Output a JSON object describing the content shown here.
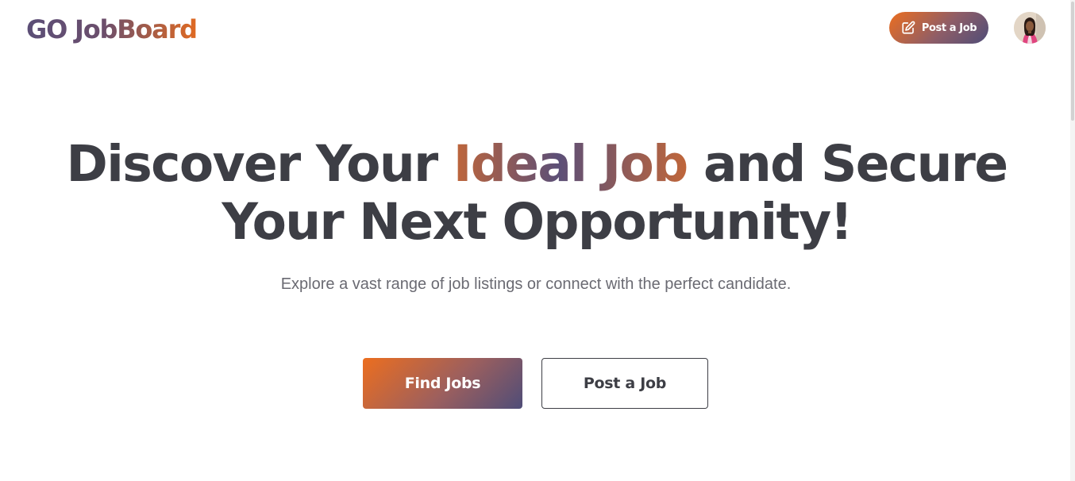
{
  "header": {
    "logo": "GO JobBoard",
    "post_job_label": "Post a Job",
    "post_job_icon": "edit-icon",
    "avatar_icon": "user-avatar"
  },
  "hero": {
    "title_pre": "Discover Your",
    "title_accent": "Ideal Job",
    "title_post": "and Secure",
    "title_line2": "Your Next Opportunity!",
    "subtitle": "Explore a vast range of job listings or connect with the perfect candidate."
  },
  "actions": {
    "find_jobs_label": "Find Jobs",
    "post_job_label": "Post a Job"
  },
  "colors": {
    "brand_orange": "#ec6e1f",
    "brand_purple": "#4f4d78",
    "text_dark": "#3d3e45",
    "text_muted": "#6a6a72"
  }
}
